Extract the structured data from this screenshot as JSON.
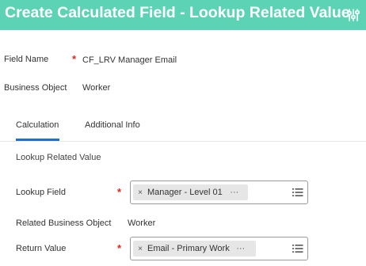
{
  "header": {
    "title": "Create Calculated Field - Lookup Related Value",
    "icon": "related-actions-icon",
    "bg_color": "#5bd3b4"
  },
  "form": {
    "field_name_label": "Field Name",
    "field_name_value": "CF_LRV Manager Email",
    "business_object_label": "Business Object",
    "business_object_value": "Worker",
    "required_mark": "*"
  },
  "tabs": [
    {
      "label": "Calculation",
      "active": true
    },
    {
      "label": "Additional Info",
      "active": false
    }
  ],
  "calculation": {
    "section_title": "Lookup Related Value",
    "lookup_field_label": "Lookup Field",
    "lookup_field_value": "Manager - Level 01",
    "related_bo_label": "Related Business Object",
    "related_bo_value": "Worker",
    "return_value_label": "Return Value",
    "return_value_value": "Email - Primary Work"
  },
  "glyphs": {
    "remove": "×",
    "more": "···"
  },
  "colors": {
    "accent": "#1f6fd0",
    "required": "#e3231b"
  }
}
